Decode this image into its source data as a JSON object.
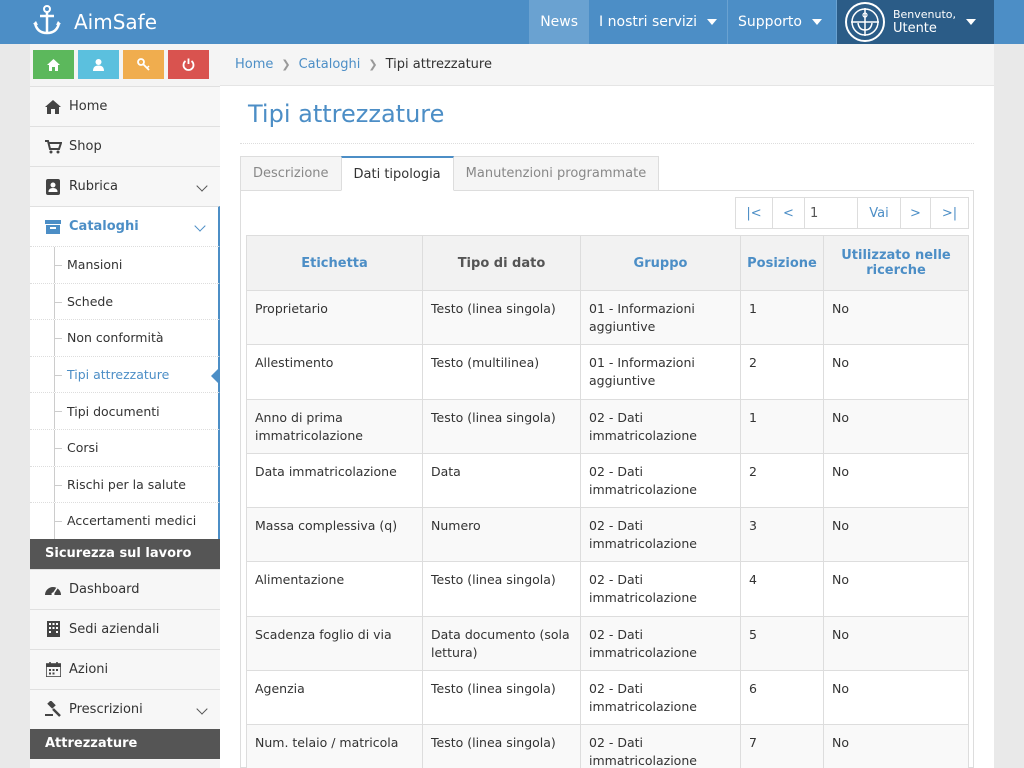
{
  "app": {
    "name": "AimSafe"
  },
  "nav": {
    "items": [
      {
        "label": "News",
        "dropdown": false,
        "active": true
      },
      {
        "label": "I nostri servizi",
        "dropdown": true,
        "active": false
      },
      {
        "label": "Supporto",
        "dropdown": true,
        "active": false
      }
    ],
    "user": {
      "welcome": "Benvenuto,",
      "name": "Utente"
    }
  },
  "shortcuts": [
    {
      "icon": "home-icon",
      "color": "#5cb85c"
    },
    {
      "icon": "user-icon",
      "color": "#5bc0de"
    },
    {
      "icon": "key-icon",
      "color": "#f0ad4e"
    },
    {
      "icon": "power-icon",
      "color": "#d9534f"
    }
  ],
  "sidebar": {
    "items": [
      {
        "label": "Home",
        "icon": "home-icon"
      },
      {
        "label": "Shop",
        "icon": "cart-icon"
      },
      {
        "label": "Rubrica",
        "icon": "contact-icon"
      },
      {
        "label": "Cataloghi",
        "icon": "archive-icon"
      }
    ],
    "submenu": [
      {
        "label": "Mansioni"
      },
      {
        "label": "Schede"
      },
      {
        "label": "Non conformità"
      },
      {
        "label": "Tipi attrezzature"
      },
      {
        "label": "Tipi documenti"
      },
      {
        "label": "Corsi"
      },
      {
        "label": "Rischi per la salute"
      },
      {
        "label": "Accertamenti medici"
      }
    ],
    "section1": "Sicurezza sul lavoro",
    "items2": [
      {
        "label": "Dashboard",
        "icon": "dashboard-icon"
      },
      {
        "label": "Sedi aziendali",
        "icon": "building-icon"
      },
      {
        "label": "Azioni",
        "icon": "calendar-icon"
      },
      {
        "label": "Prescrizioni",
        "icon": "gavel-icon"
      }
    ],
    "section2": "Attrezzature"
  },
  "breadcrumb": [
    "Home",
    "Cataloghi",
    "Tipi attrezzature"
  ],
  "page": {
    "title": "Tipi attrezzature"
  },
  "tabs": [
    "Descrizione",
    "Dati tipologia",
    "Manutenzioni programmate"
  ],
  "pager": {
    "first": "|<",
    "prev": "<",
    "page": "1",
    "go": "Vai",
    "next": ">",
    "last": ">|"
  },
  "table": {
    "headers": [
      "Etichetta",
      "Tipo di dato",
      "Gruppo",
      "Posizione",
      "Utilizzato nelle ricerche"
    ],
    "rows": [
      [
        "Proprietario",
        "Testo (linea singola)",
        "01 - Informazioni aggiuntive",
        "1",
        "No"
      ],
      [
        "Allestimento",
        "Testo (multilinea)",
        "01 - Informazioni aggiuntive",
        "2",
        "No"
      ],
      [
        "Anno di prima immatricolazione",
        "Testo (linea singola)",
        "02 - Dati immatricolazione",
        "1",
        "No"
      ],
      [
        "Data immatricolazione",
        "Data",
        "02 - Dati immatricolazione",
        "2",
        "No"
      ],
      [
        "Massa complessiva (q)",
        "Numero",
        "02 - Dati immatricolazione",
        "3",
        "No"
      ],
      [
        "Alimentazione",
        "Testo (linea singola)",
        "02 - Dati immatricolazione",
        "4",
        "No"
      ],
      [
        "Scadenza foglio di via",
        "Data documento (sola lettura)",
        "02 - Dati immatricolazione",
        "5",
        "No"
      ],
      [
        "Agenzia",
        "Testo (linea singola)",
        "02 - Dati immatricolazione",
        "6",
        "No"
      ],
      [
        "Num. telaio / matricola",
        "Testo (linea singola)",
        "02 - Dati immatricolazione",
        "7",
        "No"
      ]
    ]
  }
}
